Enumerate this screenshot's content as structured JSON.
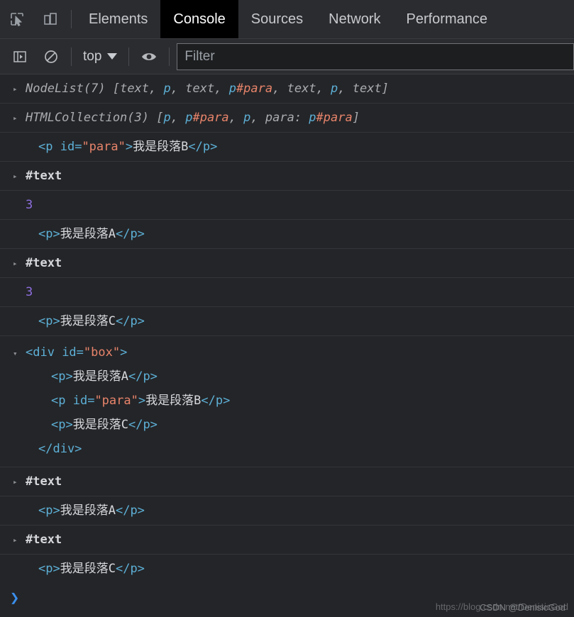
{
  "tabbar": {
    "inspect_icon": "inspect-element-icon",
    "device_icon": "device-toolbar-icon",
    "tabs": [
      {
        "label": "Elements",
        "active": false
      },
      {
        "label": "Console",
        "active": true
      },
      {
        "label": "Sources",
        "active": false
      },
      {
        "label": "Network",
        "active": false
      },
      {
        "label": "Performance",
        "active": false
      }
    ]
  },
  "console_toolbar": {
    "sidebar_icon": "console-sidebar-icon",
    "clear_icon": "clear-console-icon",
    "context": "top",
    "eye_icon": "live-expression-eye-icon",
    "filter_placeholder": "Filter",
    "filter_value": ""
  },
  "console_rows": [
    {
      "type": "object",
      "arrow": "▸",
      "prefix": "NodeList(7)",
      "parts": [
        {
          "t": " [",
          "c": "punct"
        },
        {
          "t": "text",
          "c": "grey"
        },
        {
          "t": ", ",
          "c": "punct"
        },
        {
          "t": "p",
          "c": "tagblue"
        },
        {
          "t": ", ",
          "c": "punct"
        },
        {
          "t": "text",
          "c": "grey"
        },
        {
          "t": ", ",
          "c": "punct"
        },
        {
          "t": "p",
          "c": "tagblue"
        },
        {
          "t": "#para",
          "c": "orange"
        },
        {
          "t": ", ",
          "c": "punct"
        },
        {
          "t": "text",
          "c": "grey"
        },
        {
          "t": ", ",
          "c": "punct"
        },
        {
          "t": "p",
          "c": "tagblue"
        },
        {
          "t": ", ",
          "c": "punct"
        },
        {
          "t": "text",
          "c": "grey"
        },
        {
          "t": "]",
          "c": "punct"
        }
      ]
    },
    {
      "type": "object",
      "arrow": "▸",
      "prefix": "HTMLCollection(3)",
      "parts": [
        {
          "t": " [",
          "c": "punct"
        },
        {
          "t": "p",
          "c": "tagblue"
        },
        {
          "t": ", ",
          "c": "punct"
        },
        {
          "t": "p",
          "c": "tagblue"
        },
        {
          "t": "#para",
          "c": "orange"
        },
        {
          "t": ", ",
          "c": "punct"
        },
        {
          "t": "p",
          "c": "tagblue"
        },
        {
          "t": ", ",
          "c": "punct"
        },
        {
          "t": "para: ",
          "c": "grey"
        },
        {
          "t": "p",
          "c": "tagblue"
        },
        {
          "t": "#para",
          "c": "orange"
        },
        {
          "t": "]",
          "c": "punct"
        }
      ]
    },
    {
      "type": "element",
      "arrow": "",
      "indent": 1,
      "parts": [
        {
          "t": "<p",
          "c": "tagblue"
        },
        {
          "t": " id=",
          "c": "tagblue"
        },
        {
          "t": "\"para\"",
          "c": "orange"
        },
        {
          "t": ">",
          "c": "tagblue"
        },
        {
          "t": "我是段落B",
          "c": "txt"
        },
        {
          "t": "</p>",
          "c": "tagblue"
        }
      ]
    },
    {
      "type": "text-node",
      "arrow": "▸",
      "label": "#text"
    },
    {
      "type": "number",
      "value": "3"
    },
    {
      "type": "element",
      "arrow": "",
      "indent": 1,
      "parts": [
        {
          "t": "<p>",
          "c": "tagblue"
        },
        {
          "t": "我是段落A",
          "c": "txt"
        },
        {
          "t": "</p>",
          "c": "tagblue"
        }
      ]
    },
    {
      "type": "text-node",
      "arrow": "▸",
      "label": "#text"
    },
    {
      "type": "number",
      "value": "3"
    },
    {
      "type": "element",
      "arrow": "",
      "indent": 1,
      "parts": [
        {
          "t": "<p>",
          "c": "tagblue"
        },
        {
          "t": "我是段落C",
          "c": "txt"
        },
        {
          "t": "</p>",
          "c": "tagblue"
        }
      ]
    },
    {
      "type": "expanded",
      "arrow": "▾",
      "lines": [
        {
          "indent": 0,
          "parts": [
            {
              "t": "<div",
              "c": "tagblue"
            },
            {
              "t": " id=",
              "c": "tagblue"
            },
            {
              "t": "\"box\"",
              "c": "orange"
            },
            {
              "t": ">",
              "c": "tagblue"
            }
          ]
        },
        {
          "indent": 1,
          "parts": [
            {
              "t": "<p>",
              "c": "tagblue"
            },
            {
              "t": "我是段落A",
              "c": "txt"
            },
            {
              "t": "</p>",
              "c": "tagblue"
            }
          ]
        },
        {
          "indent": 1,
          "parts": [
            {
              "t": "<p",
              "c": "tagblue"
            },
            {
              "t": " id=",
              "c": "tagblue"
            },
            {
              "t": "\"para\"",
              "c": "orange"
            },
            {
              "t": ">",
              "c": "tagblue"
            },
            {
              "t": "我是段落B",
              "c": "txt"
            },
            {
              "t": "</p>",
              "c": "tagblue"
            }
          ]
        },
        {
          "indent": 1,
          "parts": [
            {
              "t": "<p>",
              "c": "tagblue"
            },
            {
              "t": "我是段落C",
              "c": "txt"
            },
            {
              "t": "</p>",
              "c": "tagblue"
            }
          ]
        },
        {
          "indent": 0,
          "parts": [
            {
              "t": "</div>",
              "c": "tagblue"
            }
          ]
        }
      ]
    },
    {
      "type": "text-node",
      "arrow": "▸",
      "label": "#text"
    },
    {
      "type": "element",
      "arrow": "",
      "indent": 1,
      "parts": [
        {
          "t": "<p>",
          "c": "tagblue"
        },
        {
          "t": "我是段落A",
          "c": "txt"
        },
        {
          "t": "</p>",
          "c": "tagblue"
        }
      ]
    },
    {
      "type": "text-node",
      "arrow": "▸",
      "label": "#text"
    },
    {
      "type": "element",
      "arrow": "",
      "indent": 1,
      "parts": [
        {
          "t": "<p>",
          "c": "tagblue"
        },
        {
          "t": "我是段落C",
          "c": "txt"
        },
        {
          "t": "</p>",
          "c": "tagblue"
        }
      ]
    }
  ],
  "prompt": {
    "caret": "❯",
    "value": ""
  },
  "watermark": {
    "line1": "https://blog.csdn.net/DenisicGod",
    "line2": "CSDN @DenisicGod"
  },
  "colors": {
    "background": "#242528",
    "toolbar": "#2b2c30",
    "row_border": "#34353a",
    "tag_blue": "#5db0d7",
    "attr_orange": "#e8846b",
    "number_purple": "#8d6fe0",
    "text_grey": "#a9acb0",
    "prompt_blue": "#3b8eea",
    "active_tab_bg": "#000000"
  }
}
